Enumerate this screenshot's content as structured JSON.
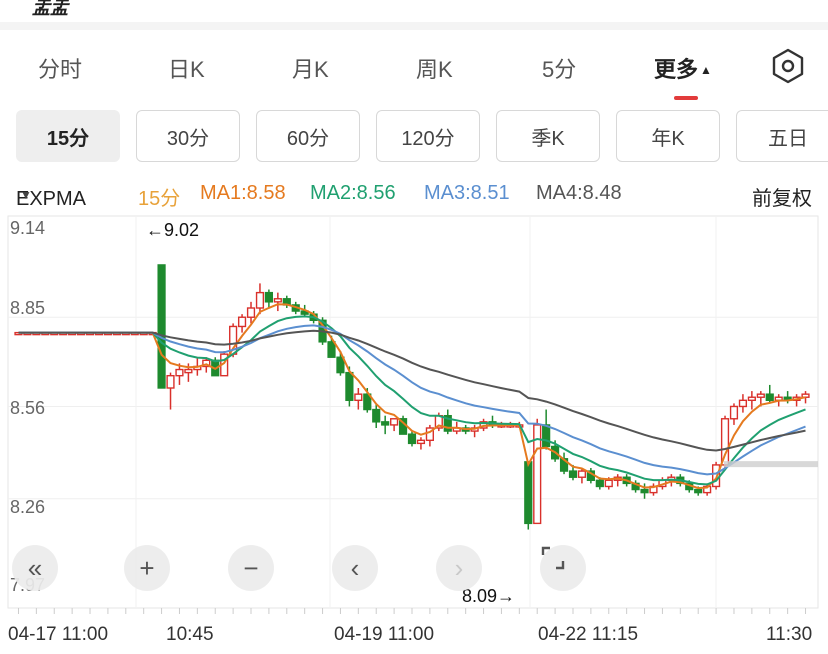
{
  "header": {
    "cut_title": "盂盂"
  },
  "tabs": [
    {
      "label": "分时"
    },
    {
      "label": "日K"
    },
    {
      "label": "月K"
    },
    {
      "label": "周K"
    },
    {
      "label": "5分"
    },
    {
      "label": "更多"
    }
  ],
  "chips": [
    {
      "label": "15分"
    },
    {
      "label": "30分"
    },
    {
      "label": "60分"
    },
    {
      "label": "120分"
    },
    {
      "label": "季K"
    },
    {
      "label": "年K"
    },
    {
      "label": "五日"
    }
  ],
  "legend": {
    "indicator": "EXPMA",
    "period": "15分",
    "ma1": "MA1:8.58",
    "ma2": "MA2:8.56",
    "ma3": "MA3:8.51",
    "ma4": "MA4:8.48",
    "adjust": "前复权"
  },
  "colors": {
    "up": "#d9302b",
    "down": "#1e8a2e",
    "ma1": "#e57a1f",
    "ma2": "#20a070",
    "ma3": "#5b8fd0",
    "ma4": "#555555",
    "accent": "#e23b3b"
  },
  "chart_data": {
    "type": "candlestick",
    "y_ticks": [
      "9.14",
      "8.85",
      "8.56",
      "8.26",
      "7.97"
    ],
    "ylim": [
      7.97,
      9.14
    ],
    "x_ticks": [
      "04-17 11:00",
      "10:45",
      "04-19 11:00",
      "04-22 11:15",
      "11:30"
    ],
    "high_annotation": "←9.02",
    "low_annotation": "8.09→",
    "candles": [
      [
        8.8,
        8.8,
        8.8,
        8.8
      ],
      [
        8.8,
        8.8,
        8.8,
        8.8
      ],
      [
        8.8,
        8.8,
        8.8,
        8.8
      ],
      [
        8.8,
        8.8,
        8.8,
        8.8
      ],
      [
        8.8,
        8.8,
        8.8,
        8.8
      ],
      [
        8.8,
        8.8,
        8.8,
        8.8
      ],
      [
        8.8,
        8.8,
        8.8,
        8.8
      ],
      [
        8.8,
        8.8,
        8.8,
        8.8
      ],
      [
        8.8,
        8.8,
        8.8,
        8.8
      ],
      [
        8.8,
        8.8,
        8.8,
        8.8
      ],
      [
        8.8,
        8.8,
        8.8,
        8.8
      ],
      [
        8.8,
        8.8,
        8.8,
        8.8
      ],
      [
        8.8,
        8.8,
        8.8,
        8.8
      ],
      [
        8.8,
        8.8,
        8.8,
        8.8
      ],
      [
        8.8,
        8.8,
        8.8,
        8.8
      ],
      [
        8.8,
        8.8,
        8.8,
        8.8
      ],
      [
        9.02,
        9.02,
        8.62,
        8.62
      ],
      [
        8.62,
        8.67,
        8.55,
        8.66
      ],
      [
        8.66,
        8.7,
        8.63,
        8.68
      ],
      [
        8.67,
        8.7,
        8.64,
        8.68
      ],
      [
        8.68,
        8.72,
        8.66,
        8.69
      ],
      [
        8.69,
        8.72,
        8.67,
        8.71
      ],
      [
        8.71,
        8.72,
        8.66,
        8.66
      ],
      [
        8.66,
        8.74,
        8.66,
        8.73
      ],
      [
        8.73,
        8.83,
        8.72,
        8.82
      ],
      [
        8.82,
        8.86,
        8.8,
        8.85
      ],
      [
        8.85,
        8.9,
        8.83,
        8.88
      ],
      [
        8.88,
        8.96,
        8.86,
        8.93
      ],
      [
        8.93,
        8.94,
        8.88,
        8.9
      ],
      [
        8.9,
        8.93,
        8.87,
        8.91
      ],
      [
        8.91,
        8.92,
        8.88,
        8.89
      ],
      [
        8.89,
        8.9,
        8.86,
        8.87
      ],
      [
        8.87,
        8.89,
        8.85,
        8.86
      ],
      [
        8.86,
        8.87,
        8.83,
        8.84
      ],
      [
        8.84,
        8.85,
        8.76,
        8.77
      ],
      [
        8.77,
        8.79,
        8.72,
        8.72
      ],
      [
        8.72,
        8.74,
        8.66,
        8.67
      ],
      [
        8.67,
        8.69,
        8.56,
        8.58
      ],
      [
        8.58,
        8.62,
        8.55,
        8.6
      ],
      [
        8.6,
        8.62,
        8.54,
        8.55
      ],
      [
        8.55,
        8.57,
        8.49,
        8.51
      ],
      [
        8.51,
        8.53,
        8.47,
        8.5
      ],
      [
        8.5,
        8.52,
        8.48,
        8.52
      ],
      [
        8.52,
        8.53,
        8.47,
        8.47
      ],
      [
        8.47,
        8.48,
        8.43,
        8.44
      ],
      [
        8.44,
        8.46,
        8.42,
        8.45
      ],
      [
        8.45,
        8.5,
        8.43,
        8.49
      ],
      [
        8.49,
        8.54,
        8.48,
        8.53
      ],
      [
        8.53,
        8.55,
        8.47,
        8.48
      ],
      [
        8.48,
        8.51,
        8.47,
        8.49
      ],
      [
        8.49,
        8.5,
        8.47,
        8.48
      ],
      [
        8.48,
        8.5,
        8.46,
        8.49
      ],
      [
        8.49,
        8.52,
        8.48,
        8.51
      ],
      [
        8.51,
        8.53,
        8.49,
        8.5
      ],
      [
        8.5,
        8.51,
        8.49,
        8.5
      ],
      [
        8.5,
        8.51,
        8.49,
        8.5
      ],
      [
        8.5,
        8.51,
        8.49,
        8.5
      ],
      [
        8.38,
        8.38,
        8.16,
        8.18
      ],
      [
        8.18,
        8.52,
        8.18,
        8.5
      ],
      [
        8.5,
        8.55,
        8.42,
        8.43
      ],
      [
        8.43,
        8.45,
        8.38,
        8.39
      ],
      [
        8.39,
        8.41,
        8.34,
        8.35
      ],
      [
        8.35,
        8.37,
        8.32,
        8.33
      ],
      [
        8.33,
        8.36,
        8.31,
        8.35
      ],
      [
        8.35,
        8.36,
        8.31,
        8.32
      ],
      [
        8.32,
        8.33,
        8.29,
        8.3
      ],
      [
        8.3,
        8.33,
        8.29,
        8.32
      ],
      [
        8.32,
        8.34,
        8.3,
        8.33
      ],
      [
        8.33,
        8.34,
        8.3,
        8.31
      ],
      [
        8.31,
        8.32,
        8.28,
        8.29
      ],
      [
        8.29,
        8.31,
        8.26,
        8.28
      ],
      [
        8.28,
        8.31,
        8.27,
        8.3
      ],
      [
        8.3,
        8.33,
        8.29,
        8.32
      ],
      [
        8.32,
        8.34,
        8.3,
        8.33
      ],
      [
        8.33,
        8.34,
        8.3,
        8.31
      ],
      [
        8.31,
        8.32,
        8.28,
        8.29
      ],
      [
        8.29,
        8.3,
        8.27,
        8.28
      ],
      [
        8.28,
        8.31,
        8.27,
        8.3
      ],
      [
        8.3,
        8.38,
        8.29,
        8.37
      ],
      [
        8.37,
        8.53,
        8.36,
        8.52
      ],
      [
        8.52,
        8.57,
        8.5,
        8.56
      ],
      [
        8.56,
        8.6,
        8.54,
        8.58
      ],
      [
        8.58,
        8.61,
        8.55,
        8.59
      ],
      [
        8.59,
        8.61,
        8.56,
        8.6
      ],
      [
        8.6,
        8.63,
        8.57,
        8.58
      ],
      [
        8.58,
        8.6,
        8.56,
        8.59
      ],
      [
        8.59,
        8.61,
        8.57,
        8.58
      ],
      [
        8.58,
        8.6,
        8.56,
        8.59
      ],
      [
        8.59,
        8.61,
        8.57,
        8.6
      ]
    ]
  },
  "controls": {
    "first": "«",
    "zoom_in": "+",
    "zoom_out": "−",
    "prev": "‹",
    "next": "›"
  }
}
